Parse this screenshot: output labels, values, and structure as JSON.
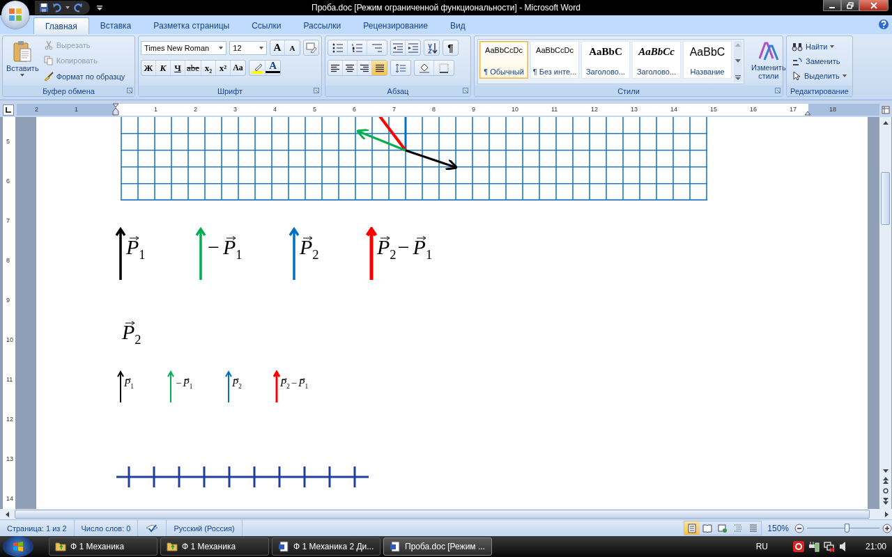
{
  "window": {
    "title": "Проба.doc [Режим ограниченной функциональности] - Microsoft Word"
  },
  "tabs": [
    {
      "label": "Главная",
      "selected": true
    },
    {
      "label": "Вставка",
      "selected": false
    },
    {
      "label": "Разметка страницы",
      "selected": false
    },
    {
      "label": "Ссылки",
      "selected": false
    },
    {
      "label": "Рассылки",
      "selected": false
    },
    {
      "label": "Рецензирование",
      "selected": false
    },
    {
      "label": "Вид",
      "selected": false
    }
  ],
  "clipboard": {
    "title": "Буфер обмена",
    "paste": "Вставить",
    "items": [
      {
        "label": "Вырезать",
        "kind": "cut",
        "disabled": true
      },
      {
        "label": "Копировать",
        "kind": "copy",
        "disabled": true
      },
      {
        "label": "Формат по образцу",
        "kind": "brush",
        "disabled": false
      }
    ]
  },
  "font": {
    "title": "Шрифт",
    "name": "Times New Roman",
    "size": "12",
    "grow": "A",
    "shrink": "A",
    "color_letter": "A",
    "formats": [
      {
        "label": "Ж",
        "kind": "bold"
      },
      {
        "label": "К",
        "kind": "italic"
      },
      {
        "label": "Ч",
        "kind": "underline"
      },
      {
        "label": "abe",
        "kind": "strike"
      },
      {
        "label": "x₂",
        "kind": "sub"
      },
      {
        "label": "x²",
        "kind": "sup"
      },
      {
        "label": "Aa",
        "kind": "case"
      }
    ]
  },
  "paragraph": {
    "title": "Абзац",
    "pilcrow": "¶",
    "alignment": [
      {
        "kind": "left",
        "selected": false
      },
      {
        "kind": "center",
        "selected": false
      },
      {
        "kind": "right",
        "selected": false
      },
      {
        "kind": "justify",
        "selected": true
      }
    ]
  },
  "styles": {
    "title": "Стили",
    "change": "Изменить стили",
    "gallery": [
      {
        "sample": "AaBbCcDc",
        "name": "¶ Обычный",
        "kind": "normal",
        "selected": true
      },
      {
        "sample": "AaBbCcDc",
        "name": "¶ Без инте...",
        "kind": "normal",
        "selected": false
      },
      {
        "sample": "AaBbC",
        "name": "Заголово...",
        "kind": "heading",
        "selected": false
      },
      {
        "sample": "AaBbCc",
        "name": "Заголово...",
        "kind": "heading_italic",
        "selected": false
      },
      {
        "sample": "AaBbC",
        "name": "Название",
        "kind": "title",
        "selected": false
      }
    ]
  },
  "editing": {
    "title": "Редактирование",
    "items": [
      {
        "label": "Найти",
        "kind": "find"
      },
      {
        "label": "Заменить",
        "kind": "replace"
      },
      {
        "label": "Выделить",
        "kind": "select"
      }
    ]
  },
  "ruler": {
    "left_marks": [
      "2",
      "1"
    ],
    "marks": [
      "1",
      "2",
      "3",
      "4",
      "5",
      "6",
      "7",
      "8",
      "9",
      "10",
      "11",
      "12",
      "13",
      "14",
      "15",
      "16",
      "17",
      "18"
    ],
    "vertical_marks": [
      "5",
      "6",
      "7",
      "8",
      "9",
      "10",
      "11",
      "12",
      "13",
      "14"
    ]
  },
  "document": {
    "large_vectors": [
      {
        "color": "#000000",
        "terms": [
          {
            "symbol": "P",
            "index": "1"
          }
        ]
      },
      {
        "color": "#00b050",
        "terms": [
          {
            "sign": "−",
            "symbol": "P",
            "index": "1"
          }
        ]
      },
      {
        "color": "#0070c0",
        "terms": [
          {
            "symbol": "P",
            "index": "2"
          }
        ]
      },
      {
        "color": "#ff0000",
        "terms": [
          {
            "symbol": "P",
            "index": "2"
          },
          {
            "sign": "−",
            "symbol": "P",
            "index": "1"
          }
        ]
      }
    ],
    "single": {
      "symbol": "P",
      "index": "2"
    },
    "small_vectors": [
      {
        "color": "#000000",
        "terms": [
          {
            "symbol": "P",
            "index": "1"
          }
        ]
      },
      {
        "color": "#00b050",
        "terms": [
          {
            "sign": "−",
            "symbol": "P",
            "index": "1"
          }
        ]
      },
      {
        "color": "#0070c0",
        "terms": [
          {
            "symbol": "P",
            "index": "2"
          }
        ]
      },
      {
        "color": "#ff0000",
        "terms": [
          {
            "symbol": "P",
            "index": "2"
          },
          {
            "sign": "−",
            "symbol": "P",
            "index": "1"
          }
        ]
      }
    ]
  },
  "status_bar": {
    "page": "Страница: 1 из 2",
    "words": "Число слов: 0",
    "language": "Русский (Россия)",
    "views": [
      {
        "kind": "print",
        "selected": true
      },
      {
        "kind": "reading",
        "selected": false
      },
      {
        "kind": "web",
        "selected": false
      },
      {
        "kind": "outline",
        "selected": false
      },
      {
        "kind": "draft",
        "selected": false
      }
    ],
    "zoom": "150%",
    "zoom_level": {
      "level": 0.55
    }
  },
  "taskbar": {
    "tasks": [
      {
        "label": "Ф 1 Механика",
        "kind": "folder",
        "selected": false
      },
      {
        "label": "Ф 1 Механика",
        "kind": "folder",
        "selected": false
      },
      {
        "label": "Ф 1 Механика 2 Ди...",
        "kind": "doc",
        "selected": false
      },
      {
        "label": "Проба.doc [Режим ...",
        "kind": "doc",
        "selected": true
      }
    ],
    "language": "RU",
    "time": "21:00"
  }
}
